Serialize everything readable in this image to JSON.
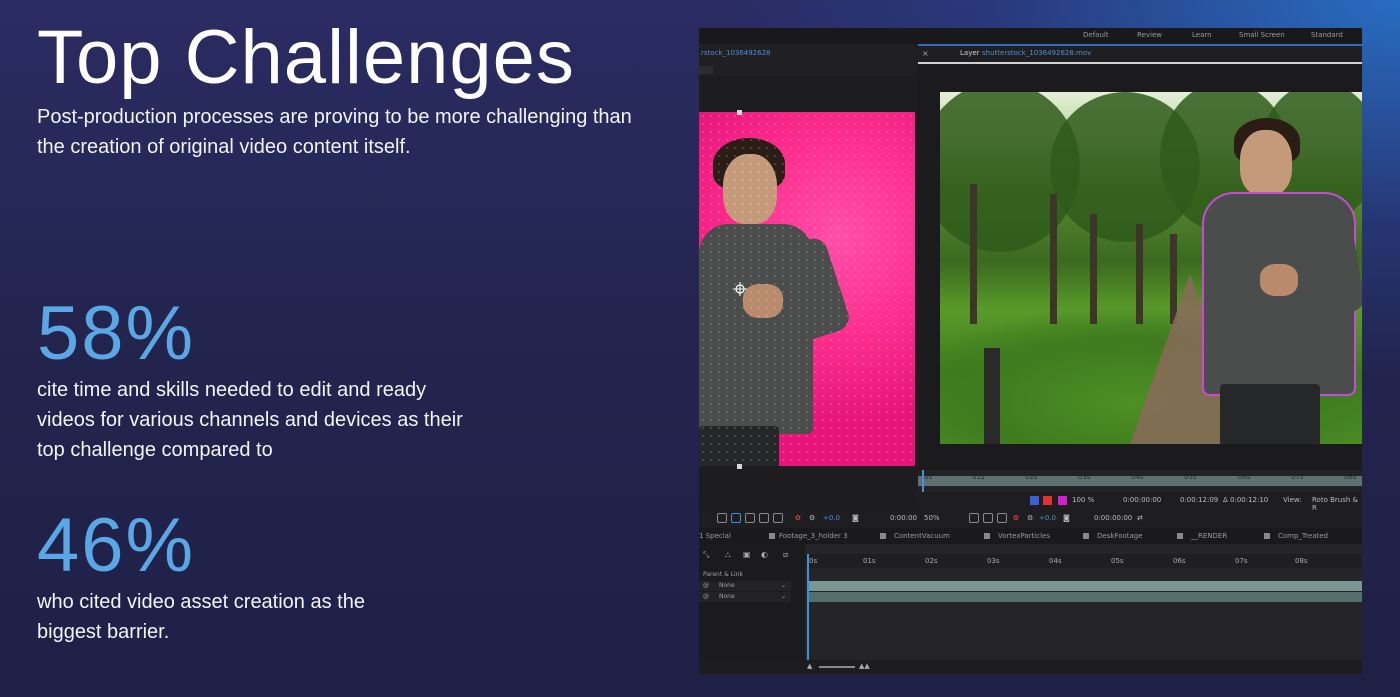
{
  "heading": {
    "title": "Top Challenges",
    "subtitle": "Post-production processes are proving to be more challenging than the creation of original video content itself."
  },
  "stats": [
    {
      "value": "58%",
      "text": "cite time and skills needed to edit and ready videos for various channels and devices as their top challenge compared to"
    },
    {
      "value": "46%",
      "text": "who cited video asset creation as the biggest barrier."
    }
  ],
  "editor": {
    "workspaces": [
      "Default",
      "Review",
      "Learn",
      "Small Screen",
      "Standard"
    ],
    "comp_name": "rstock_1036492628",
    "layer_label": "Layer",
    "layer_name": "shutterstock_1036492628.mov",
    "layer_ruler": [
      "0s",
      "01s",
      "02s",
      "03s",
      "04s",
      "05s",
      "06s",
      "07s",
      "08s"
    ],
    "layer_controls": {
      "zoom_pct": "100 %",
      "in_time": "0:00:00:00",
      "out_time": "0:00:12:09",
      "duration": "Δ 0:00:12:10",
      "view_label": "View:",
      "view_value": "Roto Brush & R"
    },
    "comp_controls": {
      "plus": "+0.0",
      "time": "0:00:00",
      "zoom": "50%",
      "plus2": "+0.0",
      "timecode": "0:00:00:00"
    },
    "timeline_tabs": [
      "1 Special",
      "Footage_3_holder 3",
      "ContentVacuum",
      "VortexParticles",
      "DeskFootage",
      "__RENDER",
      "Comp_Treated"
    ],
    "layer_rows": {
      "header": "Parent & Link",
      "parent1": "None",
      "parent2": "None"
    },
    "timeline_ruler": [
      "0s",
      "01s",
      "02s",
      "03s",
      "04s",
      "05s",
      "06s",
      "07s",
      "08s"
    ]
  },
  "colors": {
    "accent": "#5aa7e6",
    "pink": "#e7157a",
    "timeline_blue": "#3d8fe0"
  }
}
